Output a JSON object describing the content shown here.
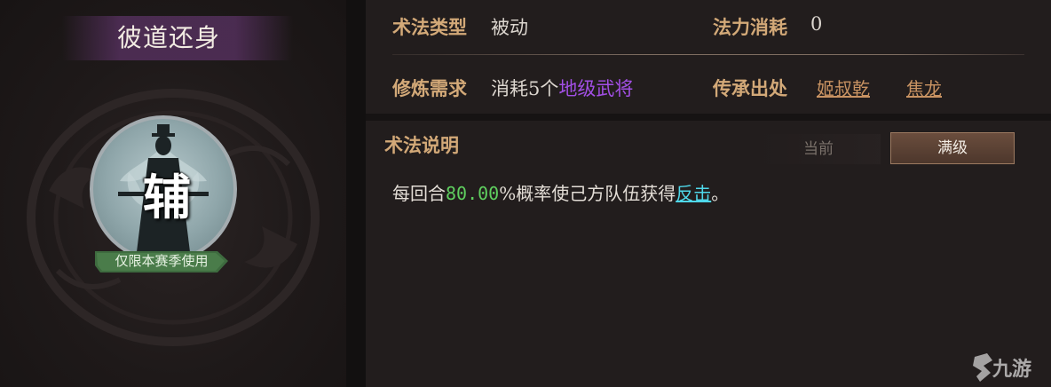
{
  "skill": {
    "name": "彼道还身",
    "role_char": "辅",
    "season_tag": "仅限本赛季使用"
  },
  "info": {
    "type_label": "术法类型",
    "type_value": "被动",
    "mana_label": "法力消耗",
    "mana_value": "0",
    "req_label": "修炼需求",
    "req_prefix": "消耗5个",
    "req_highlight": "地级武将",
    "source_label": "传承出处",
    "sources": [
      "姬叔乾",
      "焦龙"
    ]
  },
  "description": {
    "heading": "术法说明",
    "tab_current": "当前",
    "tab_max": "满级",
    "text_prefix": "每回合",
    "text_number": "80.00",
    "text_middle": "%概率使己方队伍获得",
    "text_link": "反击",
    "text_suffix": "。"
  },
  "watermark": {
    "text": "九游"
  },
  "colors": {
    "label_gold": "#d3a978",
    "highlight_purple": "#a24fe5",
    "number_green": "#5fcf5f",
    "link_cyan": "#4fd8ea",
    "source_link": "#c99362"
  },
  "icons": {
    "portrait": "hooded-figure-lotus-icon",
    "ribbon": "green-ribbon-banner",
    "watermark": "jiuyou-logo-icon"
  }
}
